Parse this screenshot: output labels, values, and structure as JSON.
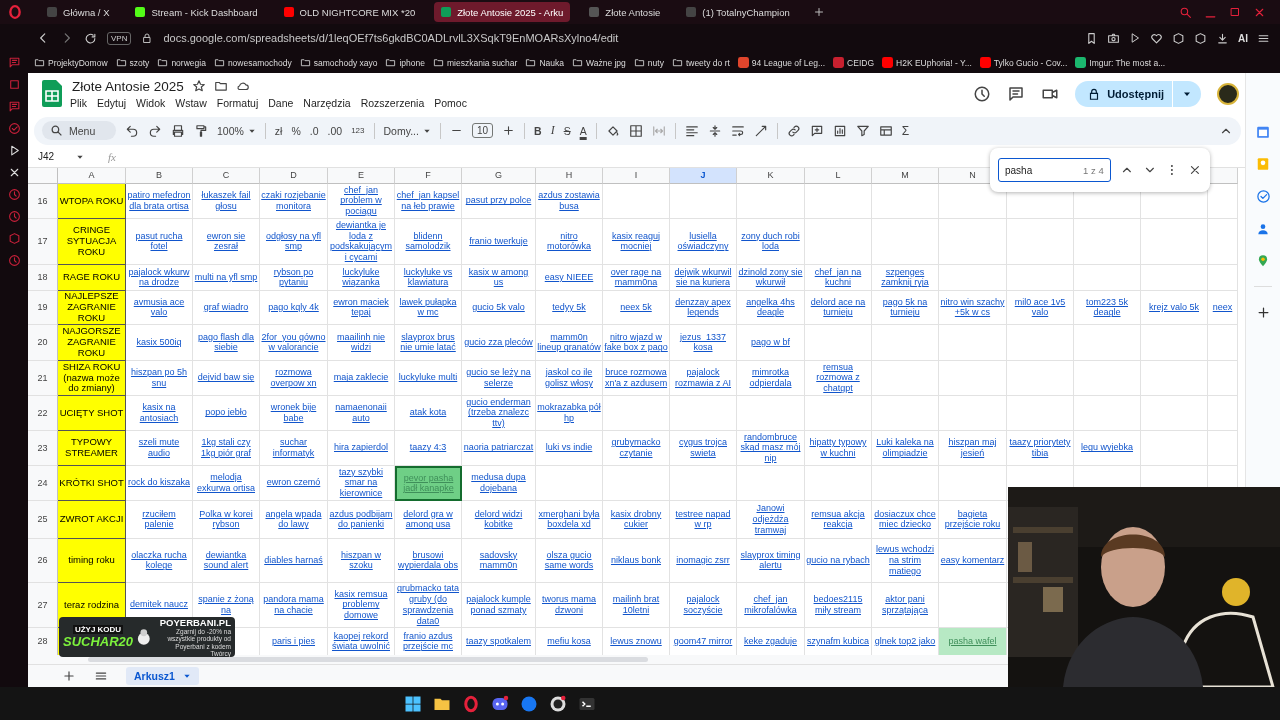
{
  "browser": {
    "tabs": [
      {
        "title": "Główna / X",
        "selected": false
      },
      {
        "title": "Stream - Kick Dashboard",
        "selected": false
      },
      {
        "title": "OLD NIGHTCORE MIX *20",
        "selected": false
      },
      {
        "title": "Złote Antosie 2025 - Arku",
        "selected": true
      },
      {
        "title": "Złote Antosie",
        "selected": false
      },
      {
        "title": "(1) TotalnyChampion",
        "selected": false
      }
    ],
    "vpn": "VPN",
    "url": "docs.google.com/spreadsheets/d/1leqOEf7ts6gkdBC0ADLrvlL3XSqkT9EnMOARsXylno4/edit",
    "ai": "AI",
    "bookmarks": [
      {
        "label": "ProjektyDomow",
        "kind": "folder"
      },
      {
        "label": "szoty",
        "kind": "folder"
      },
      {
        "label": "norwegia",
        "kind": "folder"
      },
      {
        "label": "nowesamochody",
        "kind": "folder"
      },
      {
        "label": "samochody xayo",
        "kind": "folder"
      },
      {
        "label": "iphone",
        "kind": "folder"
      },
      {
        "label": "mieszkania suchar",
        "kind": "folder"
      },
      {
        "label": "Nauka",
        "kind": "folder"
      },
      {
        "label": "Ważne jpg",
        "kind": "folder"
      },
      {
        "label": "nuty",
        "kind": "folder"
      },
      {
        "label": "tweety do rt",
        "kind": "folder"
      },
      {
        "label": "94 League of Leg...",
        "kind": "site",
        "color": "#e0452c"
      },
      {
        "label": "CEIDG",
        "kind": "site",
        "color": "#c8202f"
      },
      {
        "label": "H2K EUphoria! - Y...",
        "kind": "site",
        "color": "#ff0000"
      },
      {
        "label": "Tylko Gucio - Cov...",
        "kind": "site",
        "color": "#ff0000"
      },
      {
        "label": "Imgur: The most a...",
        "kind": "site",
        "color": "#1bb76e"
      }
    ]
  },
  "sheet": {
    "title": "Złote Antosie 2025",
    "share": "Udostępnij",
    "menu": [
      "Plik",
      "Edytuj",
      "Widok",
      "Wstaw",
      "Formatuj",
      "Dane",
      "Narzędzia",
      "Rozszerzenia",
      "Pomoc"
    ],
    "toolbar": {
      "search": "Menu",
      "zoom": "100%",
      "currency": "zł",
      "percent": "%",
      "decrease_decimals": ".0",
      "increase_decimals": ".00",
      "number_format": "123",
      "font": "Domy...",
      "font_size": "10",
      "bold": "B",
      "italic": "I",
      "strike": "S",
      "text_color": "A",
      "sum": "Σ"
    },
    "name_box": "J42",
    "fx": "fx",
    "columns": [
      {
        "label": "A",
        "selected": false
      },
      {
        "label": "B",
        "selected": false
      },
      {
        "label": "C",
        "selected": false
      },
      {
        "label": "D",
        "selected": false
      },
      {
        "label": "E",
        "selected": false
      },
      {
        "label": "F",
        "selected": false
      },
      {
        "label": "G",
        "selected": false
      },
      {
        "label": "H",
        "selected": false
      },
      {
        "label": "I",
        "selected": false
      },
      {
        "label": "J",
        "selected": true
      },
      {
        "label": "K",
        "selected": false
      },
      {
        "label": "L",
        "selected": false
      },
      {
        "label": "M",
        "selected": false
      },
      {
        "label": "N",
        "selected": false
      }
    ],
    "rows": [
      {
        "number": "16",
        "cells": [
          "WTOPA ROKU",
          "patiro mefedron dla brata ortisa",
          "łukaszek fail głosu",
          "czaki rozjebanie monitora",
          "chef_jan problem w pociągu",
          "chef_jan kapsel na łeb prawie",
          "pasut przy polce",
          "azdus zostawia busa",
          null,
          null,
          null,
          null,
          null,
          null,
          null,
          null,
          null,
          null
        ]
      },
      {
        "number": "17",
        "cells": [
          "CRINGE SYTUACJA ROKU",
          "pasut rucha fotel",
          "ewron sie zesrał",
          "odgłosy na yfl smp",
          "dewiantka je loda z podskakującym i cycami",
          "blidenn samolodzik",
          "franio twerkuje",
          "nitro motorówka",
          "kasix reaguj mocniej",
          "lusiella oświadczyny",
          "zony duch robi loda",
          null,
          null,
          null,
          null,
          null,
          null,
          null
        ]
      },
      {
        "number": "18",
        "cells": [
          "RAGE ROKU",
          "pajalock wkurw na drodze",
          "multi na yfl smp",
          "rybson po pytaniu",
          "luckyluke wiązanka",
          "luckyluke vs klawiatura",
          "kasix w among us",
          "easy NIEEE",
          "over rage na mamm0na",
          "dejwik wkurwil sie na kuriera",
          "dzinold zony sie wkurwił",
          "chef_jan na kuchni",
          "szpenges zamknij ryja",
          null,
          null,
          null,
          null,
          null
        ]
      },
      {
        "number": "19",
        "cells": [
          "NAJLEPSZE ZAGRANIE ROKU",
          "avmusia ace valo",
          "graf wiadro",
          "pago kqly 4k",
          "ewron maciek tepaj",
          "lawek pułapka w mc",
          "gucio 5k valo",
          "tedyy 5k",
          "neex 5k",
          "denzzay apex legends",
          "angelka 4hs deagle",
          "delord ace na turnieju",
          "pago 5k na turnieju",
          "nitro win szachy +5k w cs",
          "mil0 ace 1v5 valo",
          "tom223 5k deagle",
          "krejz valo 5k",
          "neex"
        ]
      },
      {
        "number": "20",
        "cells": [
          "NAJGORSZE ZAGRANIE ROKU",
          "kasix 500iq",
          "pago flash dla siebie",
          "2for_you gówno w valorancie",
          "maailinh nie widzi",
          "slayprox brus nie umie latać",
          "gucio zza pleców",
          "mamm0n lineup granatów",
          "nitro wjazd w fake box z pago",
          "jezus_1337 kosa",
          "pago w bf",
          null,
          null,
          null,
          null,
          null,
          null,
          null
        ]
      },
      {
        "number": "21",
        "cells": [
          "SHIZA ROKU (nazwa może do zmiany)",
          "hiszpan po 5h snu",
          "dejvid baw się",
          "rozmowa overpow xn",
          "maja zaklecie",
          "luckyluke multi",
          "gucio se leży na selerze",
          "jaskol co ile golisz włosy",
          "bruce rozmowa xn'a z azdusem",
          "pajalock rozmawia z AI",
          "mimrotka odpierdala",
          "remsua rozmowa z chatgpt",
          null,
          null,
          null,
          null,
          null,
          null
        ]
      },
      {
        "number": "22",
        "cells": [
          "UCIĘTY SHOT",
          "kasix na antosiach",
          "popo jebło",
          "wronek bije babe",
          "namaenonaii auto",
          "atak kota",
          "gucio enderman (trzeba znalezc ttv)",
          "mokrazabka pół hp",
          null,
          null,
          null,
          null,
          null,
          null,
          null,
          null,
          null,
          null
        ]
      },
      {
        "number": "23",
        "cells": [
          "TYPOWY STREAMER",
          "szeli mute audio",
          "1kg stali czy 1kg piór graf",
          "suchar informatyk",
          "hira zapierdol",
          "taazy 4:3",
          "naoria patriarczat",
          "luki vs indie",
          "grubymacko czytanie",
          "cygus trojca swieta",
          "randombruce skąd masz mój nip",
          "hipatty typowy w kuchni",
          "Luki kaleka na olimpiadzie",
          "hiszpan maj jesień",
          "taazy priorytety tibia",
          "legu wyjebka",
          null,
          null
        ]
      },
      {
        "number": "24",
        "cells": [
          "KRÓTKI SHOT",
          "rock do kiszaka",
          "melodja exkurwa ortisa",
          "ewron czemó",
          "tazy szybki smar na kierownice",
          {
            "text": "pevor pasha jadł kanapke",
            "found": true,
            "selected": true
          },
          "medusa dupa dojebana",
          null,
          null,
          null,
          null,
          null,
          null,
          null
        ]
      },
      {
        "number": "25",
        "cells": [
          "ZWROT AKCJI",
          "rzuciłem palenie",
          "Polka w korei rybson",
          "angela wpada do lawy",
          "azdus podbijam do panienki",
          "delord gra w among usa",
          "delord widzi kobitke",
          "xmerghani była boxdela xd",
          "kasix drobny cukier",
          "testree napad w rp",
          "Janowi odjeżdża tramwaj",
          "remsua akcja reakcja",
          "dosiaczux chce miec dziecko",
          "bagieta przejście roku"
        ]
      },
      {
        "number": "26",
        "cells": [
          "timing roku",
          "olaczka rucha kolege",
          "dewiantka sound alert",
          "diables harnaś",
          "hiszpan w szoku",
          "brusowi wypierdala obs",
          "sadovsky mamm0n",
          "olsza gucio same words",
          "niklaus bonk",
          "inomagic zsrr",
          "slayprox timing alertu",
          "gucio na rybach",
          "lewus wchodzi na strim matiego",
          "easy komentarz"
        ]
      },
      {
        "number": "27",
        "cells": [
          "teraz rodzina",
          "demitek naucz",
          "spanie z żoną na",
          "pandora mama na chacie",
          "kasix remsua problemy domowe",
          "grubmacko tata gruby (do sprawdzenia data0",
          "pajalock kumple ponad szmaty",
          "tworus mama dzwoni",
          "mailinh brat 10letni",
          "pajalock soczyście",
          "chef_jan mikrofalówka",
          "bedoes2115 miły stream",
          "aktor pani sprzątająca",
          null
        ]
      },
      {
        "number": "28",
        "cells": [
          null,
          null,
          null,
          "paris i pies",
          "kaopej rekord świata uwolnić",
          "franio azdus przejście mc",
          "taazy spotkalem",
          "mefiu kosa",
          "lewus znowu",
          "goom47 mirror",
          "keke zgaduje",
          "szynafm kubica",
          "glnek top2 jako",
          {
            "text": "pasha wafel",
            "found": true,
            "selected": false
          }
        ]
      }
    ],
    "find": {
      "value": "pasha",
      "count": "1 z 4"
    },
    "sheet_tabs": [
      {
        "label": "Arkusz1",
        "selected": true
      }
    ]
  },
  "ad": {
    "code_label": "UŻYJ KODU",
    "code": "SUCHAR20",
    "shop": "POYERBANI.PL",
    "offer": "Zgarnij do -20% na wszystkie produkty od Poyerbani z kodem Twórcy"
  }
}
